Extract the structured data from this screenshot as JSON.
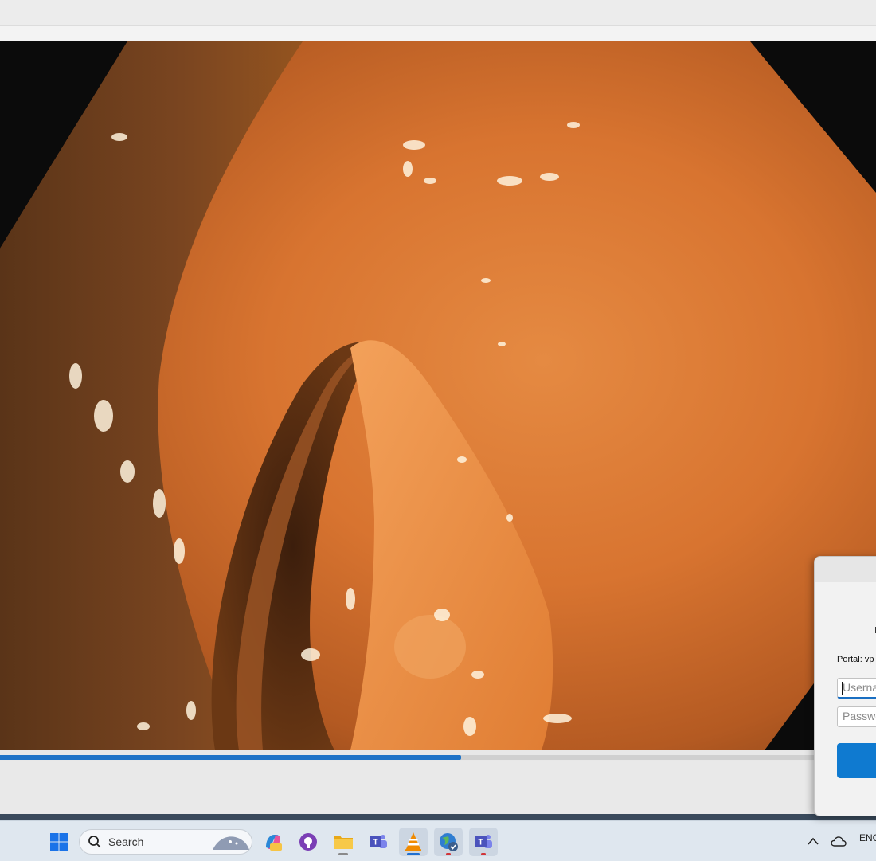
{
  "player": {
    "progress_percent": 52.6
  },
  "login_dialog": {
    "portal_label": "Portal: vp",
    "username_placeholder": "Userna",
    "password_placeholder": "Passwo"
  },
  "taskbar": {
    "search_placeholder": "Search",
    "language": "ENG",
    "apps": [
      "windows-start-icon",
      "copilot-icon",
      "github-desktop-icon",
      "file-explorer-icon",
      "teams-icon",
      "vlc-icon",
      "vpn-globe-icon",
      "teams-work-icon"
    ]
  },
  "colors": {
    "accent": "#1f73c7",
    "connect_button": "#0f7ad0",
    "tissue": "#d9752e"
  }
}
